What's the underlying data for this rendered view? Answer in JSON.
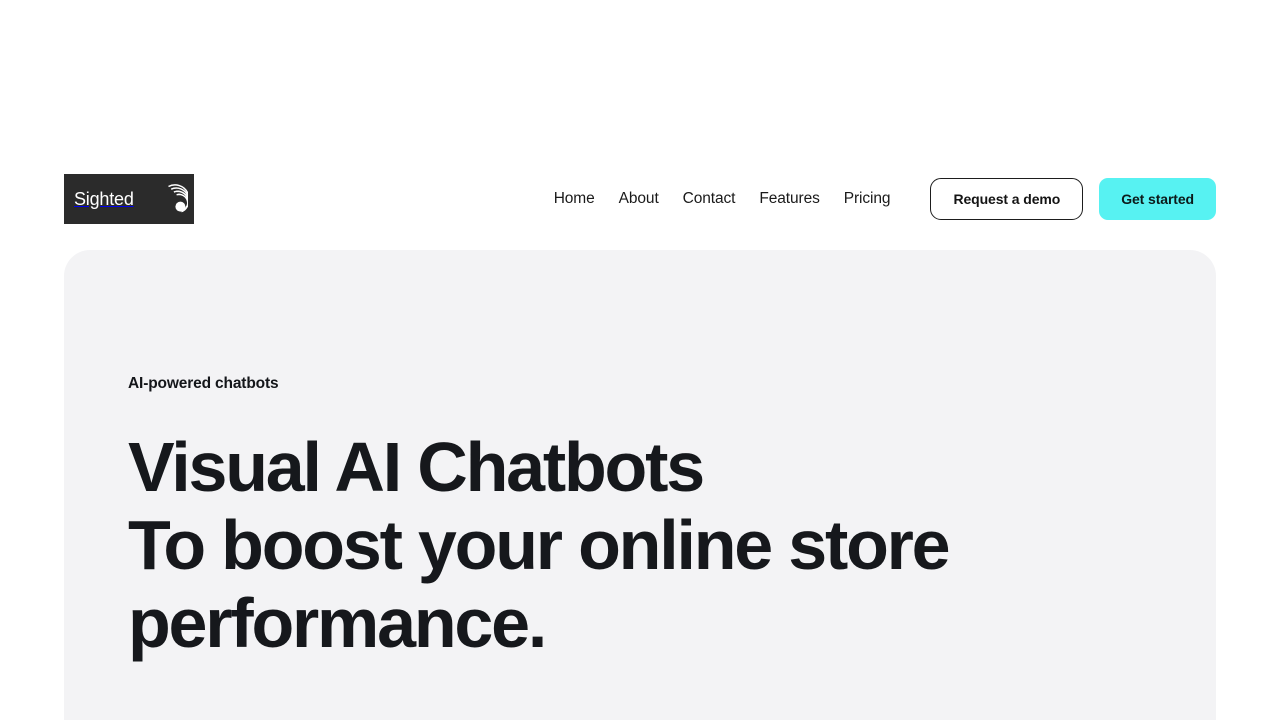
{
  "brand": {
    "name": "Sighted",
    "logo_icon": "concentric-shell-spiral-icon",
    "background_color": "#2b2b2b",
    "text_color": "#ffffff"
  },
  "nav": {
    "items": [
      {
        "label": "Home"
      },
      {
        "label": "About"
      },
      {
        "label": "Contact"
      },
      {
        "label": "Features"
      },
      {
        "label": "Pricing"
      }
    ]
  },
  "header_actions": {
    "request_demo_label": "Request a demo",
    "get_started_label": "Get started",
    "primary_color": "#57f2f2"
  },
  "hero": {
    "eyebrow": "AI-powered chatbots",
    "title_lines": [
      "Visual AI Chatbots",
      "To boost your online store",
      "performance."
    ],
    "background_color": "#f3f3f5"
  }
}
